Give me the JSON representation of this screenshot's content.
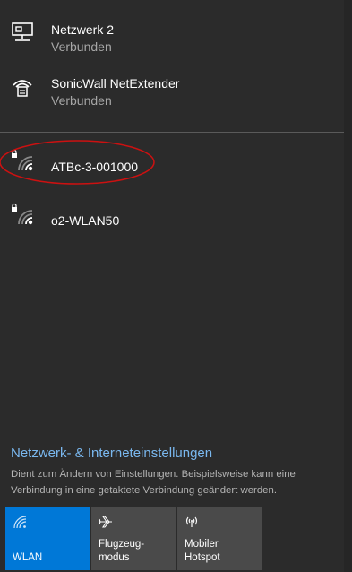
{
  "networks": {
    "wired": {
      "name": "Netzwerk 2",
      "status": "Verbunden",
      "icon": "ethernet-icon"
    },
    "vpn": {
      "name": "SonicWall NetExtender",
      "status": "Verbunden",
      "icon": "vpn-icon"
    },
    "wifi": [
      {
        "name": "ATBc-3-001000",
        "icon": "wifi-secured-icon"
      },
      {
        "name": "o2-WLAN50",
        "icon": "wifi-secured-icon"
      }
    ]
  },
  "settings": {
    "link": "Netzwerk- & Interneteinstellungen",
    "description": "Dient zum Ändern von Einstellungen. Beispielsweise kann eine Verbindung in eine getaktete Verbindung geändert werden."
  },
  "quick_actions": [
    {
      "label_line1": "WLAN",
      "label_line2": "",
      "active": true,
      "icon": "wifi-icon"
    },
    {
      "label_line1": "Flugzeug-",
      "label_line2": "modus",
      "active": false,
      "icon": "airplane-icon"
    },
    {
      "label_line1": "Mobiler",
      "label_line2": "Hotspot",
      "active": false,
      "icon": "hotspot-icon"
    }
  ],
  "colors": {
    "background": "#2b2b2b",
    "accent": "#0078d7",
    "link": "#7ab8ef",
    "annotation": "#cc1111"
  }
}
